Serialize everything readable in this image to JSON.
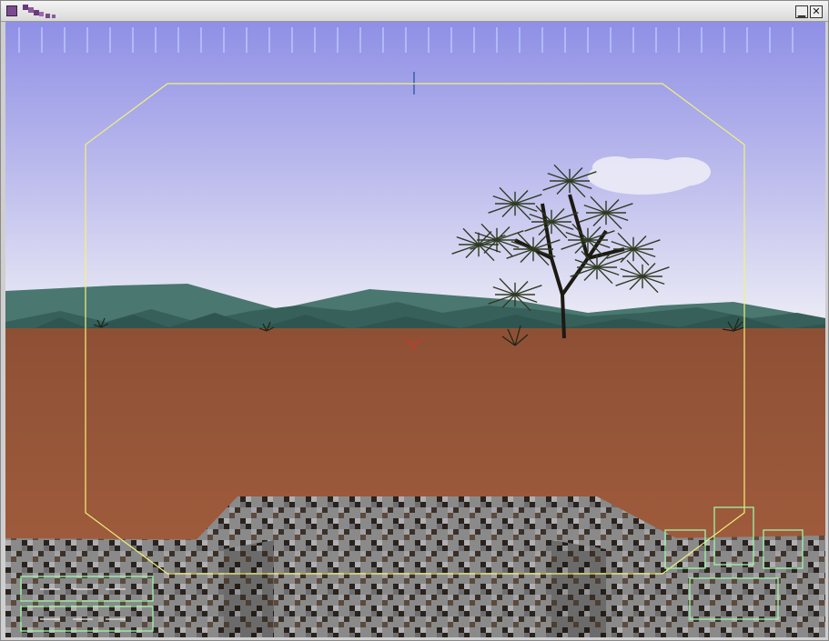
{
  "window": {
    "title": "",
    "minimize_label": "▁",
    "close_label": "✕"
  },
  "hud": {
    "compass_tick_count": 35,
    "colors": {
      "reticle": "#f2f27a",
      "panels": "#9ff5a8",
      "crosshair": "#c63a2a",
      "heading_marker": "#3a5ea8"
    }
  },
  "scene": {
    "colors": {
      "sky_top": "#8f8fe6",
      "sky_bottom": "#e7e6f3",
      "ground": "#9e5a3a",
      "mountains": "#3f6b66",
      "tree_foliage": "#2e3a22",
      "tree_trunk": "#1c1a12"
    }
  }
}
